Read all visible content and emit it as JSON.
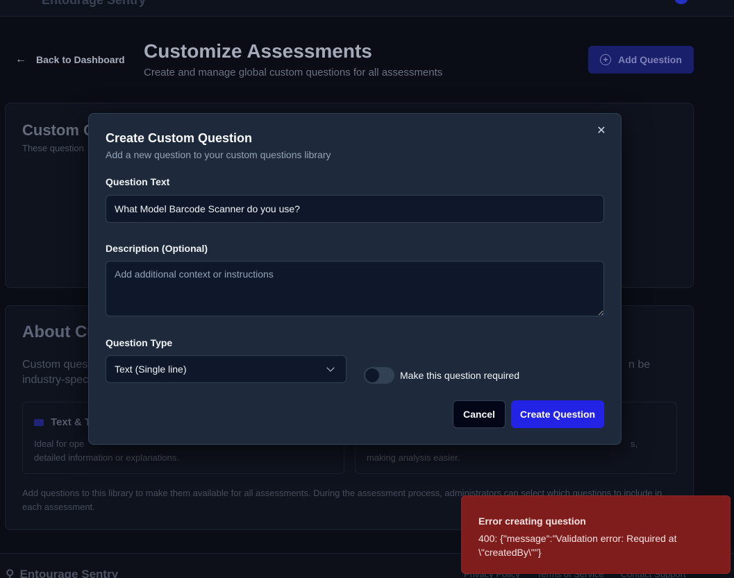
{
  "header": {
    "brand_ghost": "Entourage Sentry"
  },
  "page": {
    "back_label": "Back to Dashboard",
    "title": "Customize Assessments",
    "subtitle": "Create and manage global custom questions for all assessments",
    "add_question_label": "Add Question"
  },
  "custom_card": {
    "title": "Custom Q",
    "subtitle": "These question"
  },
  "about_card": {
    "title": "About Cu",
    "text_left_line1": "Custom quest",
    "text_left_line2": "industry-spec",
    "text_right": "n be",
    "left_box": {
      "heading": "Text & T",
      "text_line1": "Ideal for ope",
      "text_line2": "detailed information or explanations."
    },
    "right_box": {
      "text_line1": "s,",
      "text_line2": "making analysis easier."
    },
    "footer_note": "Add questions to this library to make them available for all assessments. During the assessment process, administrators can select which questions to include in each assessment."
  },
  "footer": {
    "brand": "Entourage Sentry",
    "links": [
      "Privacy Policy",
      "Terms of Service",
      "Contact Support"
    ]
  },
  "modal": {
    "title": "Create Custom Question",
    "description": "Add a new question to your custom questions library",
    "question_text_label": "Question Text",
    "question_text_value": "What Model Barcode Scanner do you use?",
    "description_label": "Description (Optional)",
    "description_placeholder": "Add additional context or instructions",
    "question_type_label": "Question Type",
    "question_type_value": "Text (Single line)",
    "required_toggle_label": "Make this question required",
    "required": false,
    "cancel_label": "Cancel",
    "create_label": "Create Question",
    "close_glyph": "✕"
  },
  "toast": {
    "title": "Error creating question",
    "message": "400: {\"message\":\"Validation error: Required at \\\"createdBy\\\"\"}"
  },
  "colors": {
    "background": "#0a0d16",
    "modal_bg": "#1e293b",
    "primary": "#2323e6",
    "error": "#7f1d1d"
  }
}
